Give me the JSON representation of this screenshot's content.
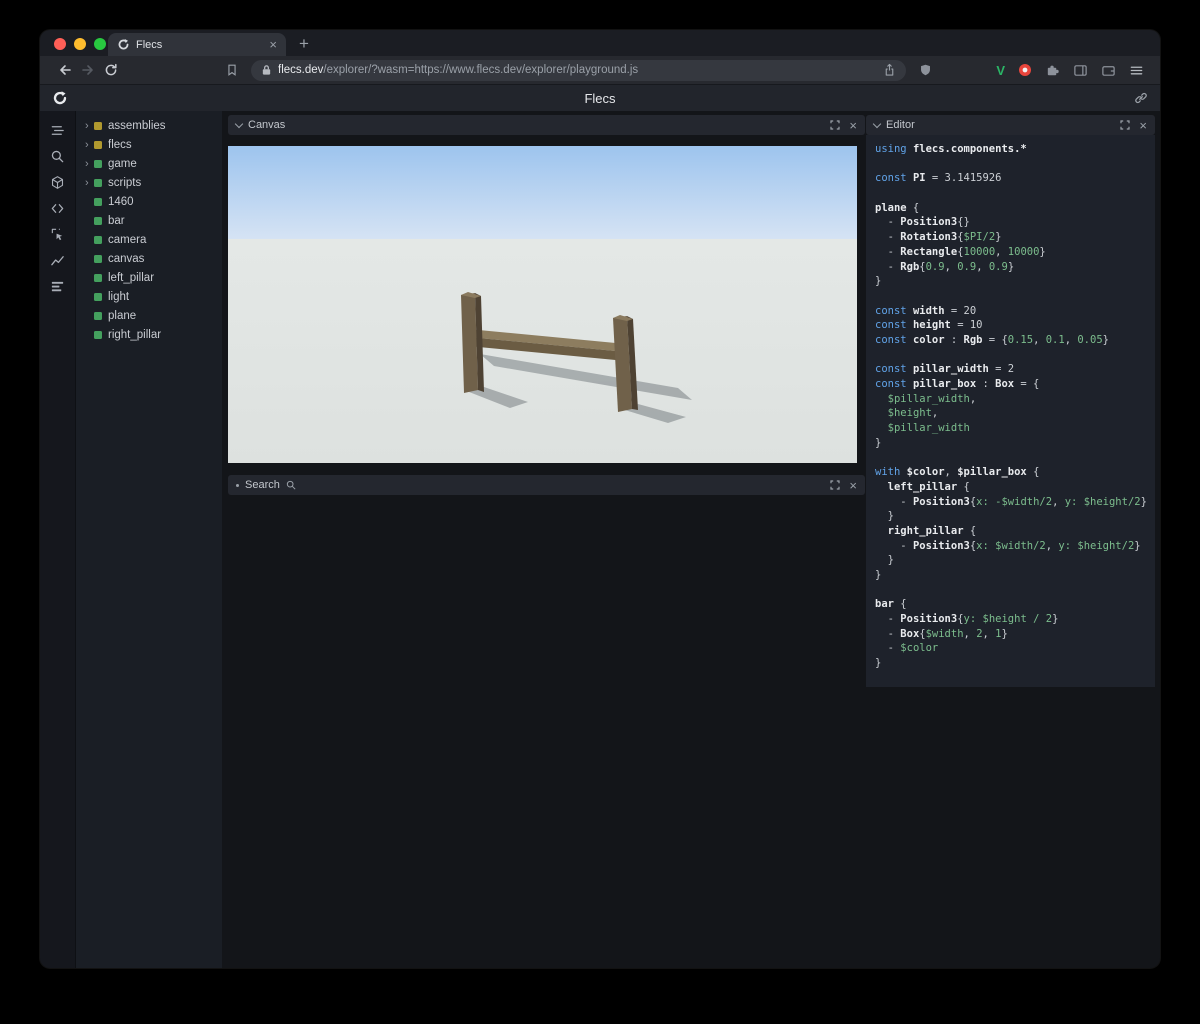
{
  "browser": {
    "tab_title": "Flecs",
    "url_domain": "flecs.dev",
    "url_rest": "/explorer/?wasm=https://www.flecs.dev/explorer/playground.js"
  },
  "header": {
    "title": "Flecs"
  },
  "sidebar": {
    "icons": [
      "outline",
      "search",
      "entities",
      "code",
      "inspector",
      "charts",
      "stats"
    ]
  },
  "icons": {
    "back": "arrow-left",
    "forward": "arrow-right",
    "reload": "circular-arrow",
    "bookmark": "bookmark-flag",
    "lock": "padlock",
    "share": "box-up-arrow",
    "shield": "brave-shield",
    "extension_v": "V",
    "extension_red": "red-circle",
    "puzzle": "puzzle-piece",
    "sidebar_toggle": "split-rectangle",
    "wallet": "wallet-card",
    "menu": "hamburger",
    "link": "chain-link",
    "expand": "corner-brackets",
    "close": "×",
    "magnifier": "magnifier",
    "collapse": "chevron-down",
    "tree_expand": "›"
  },
  "colors": {
    "yellow": "#b0992f",
    "green": "#44a05e",
    "keyword": "#61a3e8",
    "value": "#7cbd8d",
    "traffic_red": "#ff5f57",
    "traffic_yellow": "#febc2e",
    "traffic_green": "#28c840",
    "sky_top": "#9dc4ee",
    "sky_bottom": "#d7e4f4",
    "ground": "#e1e5e3",
    "pillar_front": "#70614a",
    "pillar_side": "#4e4233",
    "bar_top": "#8d7d5f"
  },
  "tree": {
    "items": [
      {
        "label": "assemblies",
        "expandable": true,
        "color": "yellow"
      },
      {
        "label": "flecs",
        "expandable": true,
        "color": "yellow"
      },
      {
        "label": "game",
        "expandable": true,
        "color": "green"
      },
      {
        "label": "scripts",
        "expandable": true,
        "color": "green"
      },
      {
        "label": "1460",
        "expandable": false,
        "color": "green"
      },
      {
        "label": "bar",
        "expandable": false,
        "color": "green"
      },
      {
        "label": "camera",
        "expandable": false,
        "color": "green"
      },
      {
        "label": "canvas",
        "expandable": false,
        "color": "green"
      },
      {
        "label": "left_pillar",
        "expandable": false,
        "color": "green"
      },
      {
        "label": "light",
        "expandable": false,
        "color": "green"
      },
      {
        "label": "plane",
        "expandable": false,
        "color": "green"
      },
      {
        "label": "right_pillar",
        "expandable": false,
        "color": "green"
      }
    ]
  },
  "panels": {
    "canvas": {
      "title": "Canvas"
    },
    "search": {
      "title": "Search"
    },
    "editor": {
      "title": "Editor",
      "code": [
        [
          [
            "kw",
            "using "
          ],
          [
            "id",
            "flecs.components.*"
          ]
        ],
        [],
        [
          [
            "kw",
            "const "
          ],
          [
            "id",
            "PI"
          ],
          [
            "pl",
            " = 3.1415926"
          ]
        ],
        [],
        [
          [
            "id",
            "plane"
          ],
          [
            "pl",
            " {"
          ]
        ],
        [
          [
            "pl",
            "  - "
          ],
          [
            "id",
            "Position3"
          ],
          [
            "pl",
            "{}"
          ]
        ],
        [
          [
            "pl",
            "  - "
          ],
          [
            "id",
            "Rotation3"
          ],
          [
            "pl",
            "{"
          ],
          [
            "vr",
            "$PI/2"
          ],
          [
            "pl",
            "}"
          ]
        ],
        [
          [
            "pl",
            "  - "
          ],
          [
            "id",
            "Rectangle"
          ],
          [
            "pl",
            "{"
          ],
          [
            "vr",
            "10000"
          ],
          [
            "pl",
            ", "
          ],
          [
            "vr",
            "10000"
          ],
          [
            "pl",
            "}"
          ]
        ],
        [
          [
            "pl",
            "  - "
          ],
          [
            "id",
            "Rgb"
          ],
          [
            "pl",
            "{"
          ],
          [
            "vr",
            "0.9"
          ],
          [
            "pl",
            ", "
          ],
          [
            "vr",
            "0.9"
          ],
          [
            "pl",
            ", "
          ],
          [
            "vr",
            "0.9"
          ],
          [
            "pl",
            "}"
          ]
        ],
        [
          [
            "pl",
            "}"
          ]
        ],
        [],
        [
          [
            "kw",
            "const "
          ],
          [
            "id",
            "width"
          ],
          [
            "pl",
            " = 20"
          ]
        ],
        [
          [
            "kw",
            "const "
          ],
          [
            "id",
            "height"
          ],
          [
            "pl",
            " = 10"
          ]
        ],
        [
          [
            "kw",
            "const "
          ],
          [
            "id",
            "color"
          ],
          [
            "pl",
            " : "
          ],
          [
            "id",
            "Rgb"
          ],
          [
            "pl",
            " = {"
          ],
          [
            "vr",
            "0.15"
          ],
          [
            "pl",
            ", "
          ],
          [
            "vr",
            "0.1"
          ],
          [
            "pl",
            ", "
          ],
          [
            "vr",
            "0.05"
          ],
          [
            "pl",
            "}"
          ]
        ],
        [],
        [
          [
            "kw",
            "const "
          ],
          [
            "id",
            "pillar_width"
          ],
          [
            "pl",
            " = 2"
          ]
        ],
        [
          [
            "kw",
            "const "
          ],
          [
            "id",
            "pillar_box"
          ],
          [
            "pl",
            " : "
          ],
          [
            "id",
            "Box"
          ],
          [
            "pl",
            " = {"
          ]
        ],
        [
          [
            "pl",
            "  "
          ],
          [
            "vr",
            "$pillar_width"
          ],
          [
            "pl",
            ","
          ]
        ],
        [
          [
            "pl",
            "  "
          ],
          [
            "vr",
            "$height"
          ],
          [
            "pl",
            ","
          ]
        ],
        [
          [
            "pl",
            "  "
          ],
          [
            "vr",
            "$pillar_width"
          ]
        ],
        [
          [
            "pl",
            "}"
          ]
        ],
        [],
        [
          [
            "kw",
            "with "
          ],
          [
            "id",
            "$color"
          ],
          [
            "pl",
            ", "
          ],
          [
            "id",
            "$pillar_box"
          ],
          [
            "pl",
            " {"
          ]
        ],
        [
          [
            "pl",
            "  "
          ],
          [
            "id",
            "left_pillar"
          ],
          [
            "pl",
            " {"
          ]
        ],
        [
          [
            "pl",
            "    - "
          ],
          [
            "id",
            "Position3"
          ],
          [
            "pl",
            "{"
          ],
          [
            "vr",
            "x:"
          ],
          [
            "pl",
            " "
          ],
          [
            "vr",
            "-$width/2"
          ],
          [
            "pl",
            ", "
          ],
          [
            "vr",
            "y:"
          ],
          [
            "pl",
            " "
          ],
          [
            "vr",
            "$height/2"
          ],
          [
            "pl",
            "}"
          ]
        ],
        [
          [
            "pl",
            "  }"
          ]
        ],
        [
          [
            "pl",
            "  "
          ],
          [
            "id",
            "right_pillar"
          ],
          [
            "pl",
            " {"
          ]
        ],
        [
          [
            "pl",
            "    - "
          ],
          [
            "id",
            "Position3"
          ],
          [
            "pl",
            "{"
          ],
          [
            "vr",
            "x:"
          ],
          [
            "pl",
            " "
          ],
          [
            "vr",
            "$width/2"
          ],
          [
            "pl",
            ", "
          ],
          [
            "vr",
            "y:"
          ],
          [
            "pl",
            " "
          ],
          [
            "vr",
            "$height/2"
          ],
          [
            "pl",
            "}"
          ]
        ],
        [
          [
            "pl",
            "  }"
          ]
        ],
        [
          [
            "pl",
            "}"
          ]
        ],
        [],
        [
          [
            "id",
            "bar"
          ],
          [
            "pl",
            " {"
          ]
        ],
        [
          [
            "pl",
            "  - "
          ],
          [
            "id",
            "Position3"
          ],
          [
            "pl",
            "{"
          ],
          [
            "vr",
            "y:"
          ],
          [
            "pl",
            " "
          ],
          [
            "vr",
            "$height / 2"
          ],
          [
            "pl",
            "}"
          ]
        ],
        [
          [
            "pl",
            "  - "
          ],
          [
            "id",
            "Box"
          ],
          [
            "pl",
            "{"
          ],
          [
            "vr",
            "$width"
          ],
          [
            "pl",
            ", "
          ],
          [
            "vr",
            "2"
          ],
          [
            "pl",
            ", "
          ],
          [
            "vr",
            "1"
          ],
          [
            "pl",
            "}"
          ]
        ],
        [
          [
            "pl",
            "  - "
          ],
          [
            "vr",
            "$color"
          ]
        ],
        [
          [
            "pl",
            "}"
          ]
        ]
      ]
    }
  }
}
